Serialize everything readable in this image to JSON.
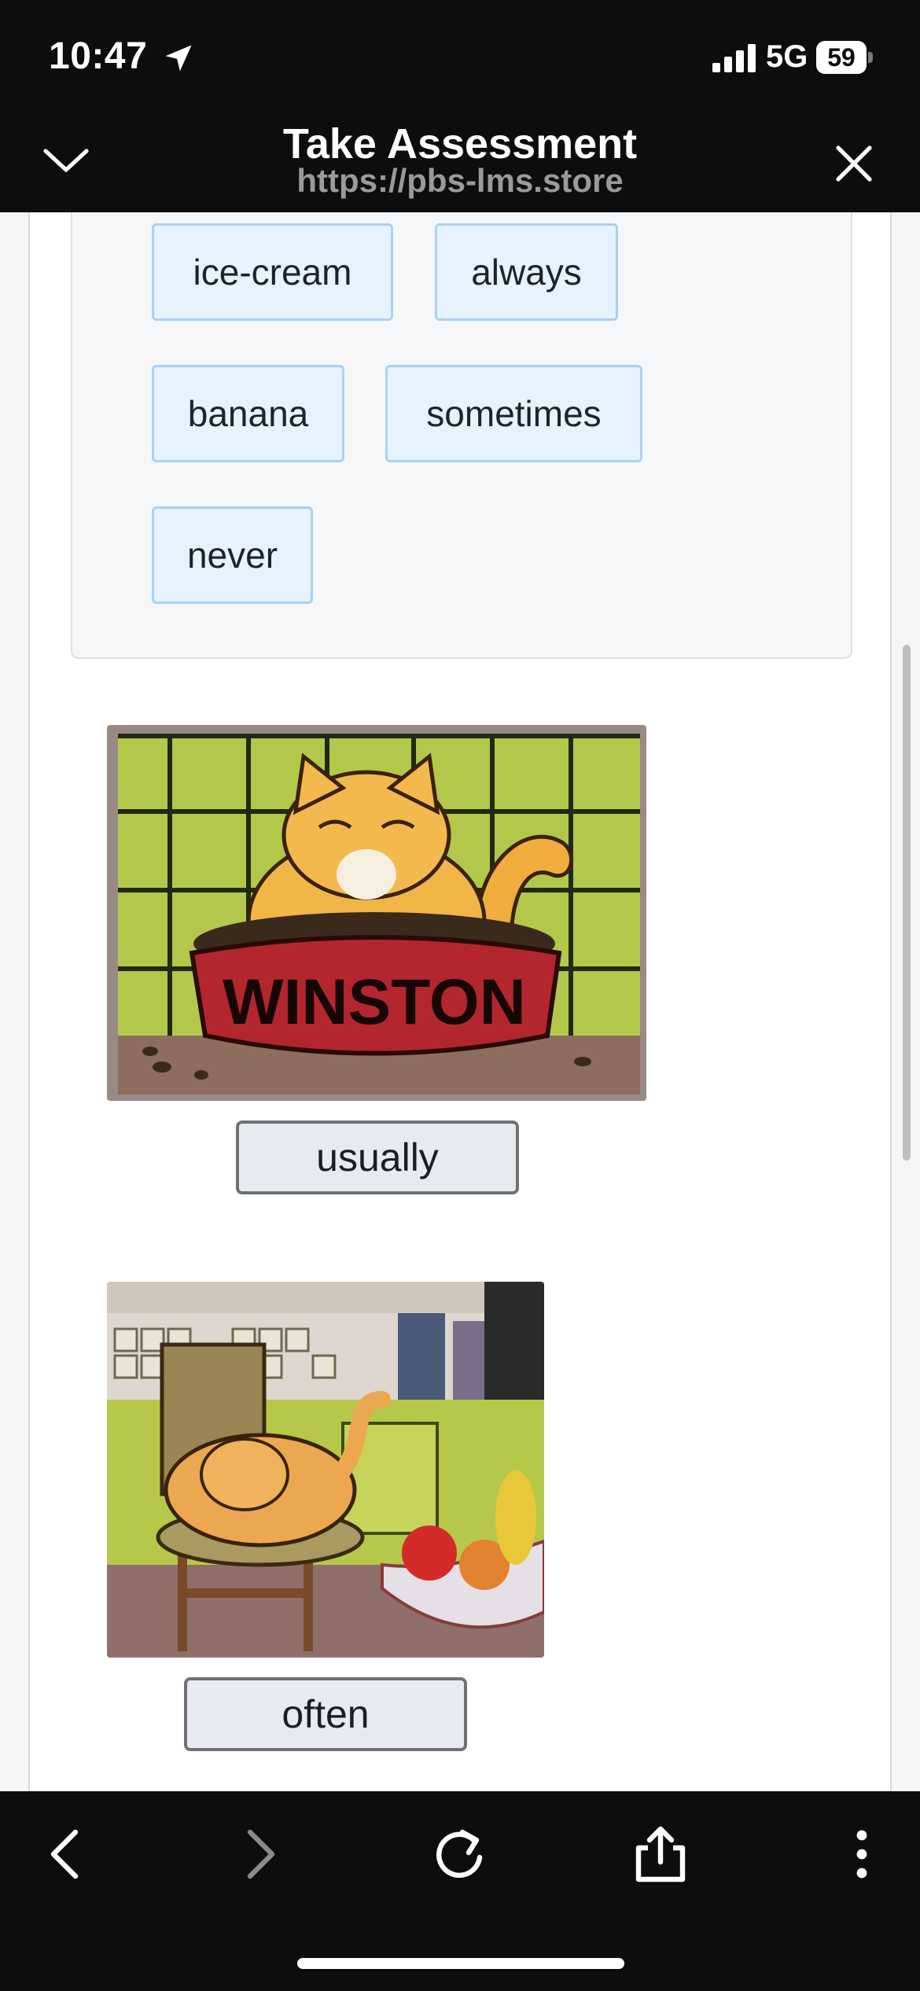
{
  "status_bar": {
    "time": "10:47",
    "network": "5G",
    "battery": "59"
  },
  "header": {
    "title": "Take Assessment",
    "url": "https://pbs-lms.store"
  },
  "word_bank": {
    "words": [
      "ice-cream",
      "always",
      "banana",
      "sometimes",
      "never"
    ]
  },
  "questions": [
    {
      "picture_text": "WINSTON",
      "answer": "usually"
    },
    {
      "answer": "often"
    }
  ],
  "colors": {
    "chip_bg": "#e6f2fd",
    "chip_border": "#a8d1f4",
    "answer_bg": "#e8ebee"
  }
}
